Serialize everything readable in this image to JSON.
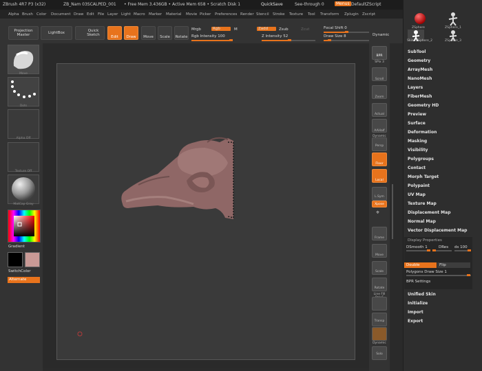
{
  "titlebar": {
    "app": "ZBrush 4R7 P3 (x32)",
    "doc": "ZB_Nam 03SCALPED_001",
    "mem": "• Free Mem 3.436GB • Active Mem 658 • Scratch Disk 1",
    "quicksave": "QuickSave",
    "seethrough": "See-through 0",
    "menus": "Menus",
    "script": "DefaultZScript"
  },
  "menubar": [
    "Alpha",
    "Brush",
    "Color",
    "Document",
    "Draw",
    "Edit",
    "File",
    "Layer",
    "Light",
    "Macro",
    "Marker",
    "Material",
    "Movie",
    "Picker",
    "Preferences",
    "Render",
    "Stencil",
    "Stroke",
    "Texture",
    "Tool",
    "Transform",
    "Zplugin",
    "Zscript"
  ],
  "toolbar": {
    "projection_master": "Projection Master",
    "lightbox": "LightBox",
    "quick_sketch": "Quick Sketch",
    "edit": "Edit",
    "draw": "Draw",
    "move": "Move",
    "scale": "Scale",
    "rotate": "Rotate",
    "mrgb": "Mrgb",
    "rgb": "Rgb",
    "m": "M",
    "zadd": "Zadd",
    "zsub": "Zsub",
    "zcut": "Zcut",
    "rgb_intensity": "Rgb Intensity 100",
    "z_intensity": "Z Intensity 52",
    "focal_shift": "Focal Shift 0",
    "draw_size": "Draw Size 8",
    "dynamic": "Dynamic"
  },
  "leftshelf": {
    "brush_cap": "Move",
    "stroke_cap": "Dots",
    "alpha_cap": "Alpha Off",
    "texture_cap": "Texture Off",
    "material_cap": "MatCap Gray",
    "gradient": "Gradient",
    "switchcolor": "SwitchColor",
    "alternate": "Alternate"
  },
  "righttools": [
    "BPR",
    "SPix 3",
    "Scroll",
    "Zoom",
    "Actual",
    "AAHalf",
    "Dynamic",
    "Persp",
    "Floor",
    "Local",
    "L.Sym",
    "Xpose",
    "Frame",
    "Move",
    "Scale",
    "Rotate",
    "Line Fill PolyF",
    "Transp",
    "Dynamic",
    "Solo"
  ],
  "palette": {
    "tool1": "ZSphere",
    "tool2": "ZSphere_1",
    "tool3": "Skin",
    "tool4": "ZSphere_2",
    "tool5": "ZSphere_3",
    "items": [
      "SubTool",
      "Geometry",
      "ArrayMesh",
      "NanoMesh",
      "Layers",
      "FiberMesh",
      "Geometry HD",
      "Preview",
      "Surface",
      "Deformation",
      "Masking",
      "Visibility",
      "Polygroups",
      "Contact",
      "Morph Target",
      "Polypaint",
      "UV Map",
      "Texture Map",
      "Displacement Map",
      "Normal Map",
      "Vector Displacement Map"
    ],
    "display_properties": "Display Properties",
    "dsmooth": "DSmooth 1",
    "dres": "DRes",
    "ds": "ds 100",
    "double": "Double",
    "flip": "Flip",
    "polygons_draw_size": "Polygons Draw Size 1",
    "bpr_settings": "BPR Settings",
    "items_bottom": [
      "Unified Skin",
      "Initialize",
      "Import",
      "Export"
    ]
  },
  "colors": {
    "accent": "#e8731c",
    "model": "#8f6766",
    "secondary_color": "#c99a96"
  }
}
